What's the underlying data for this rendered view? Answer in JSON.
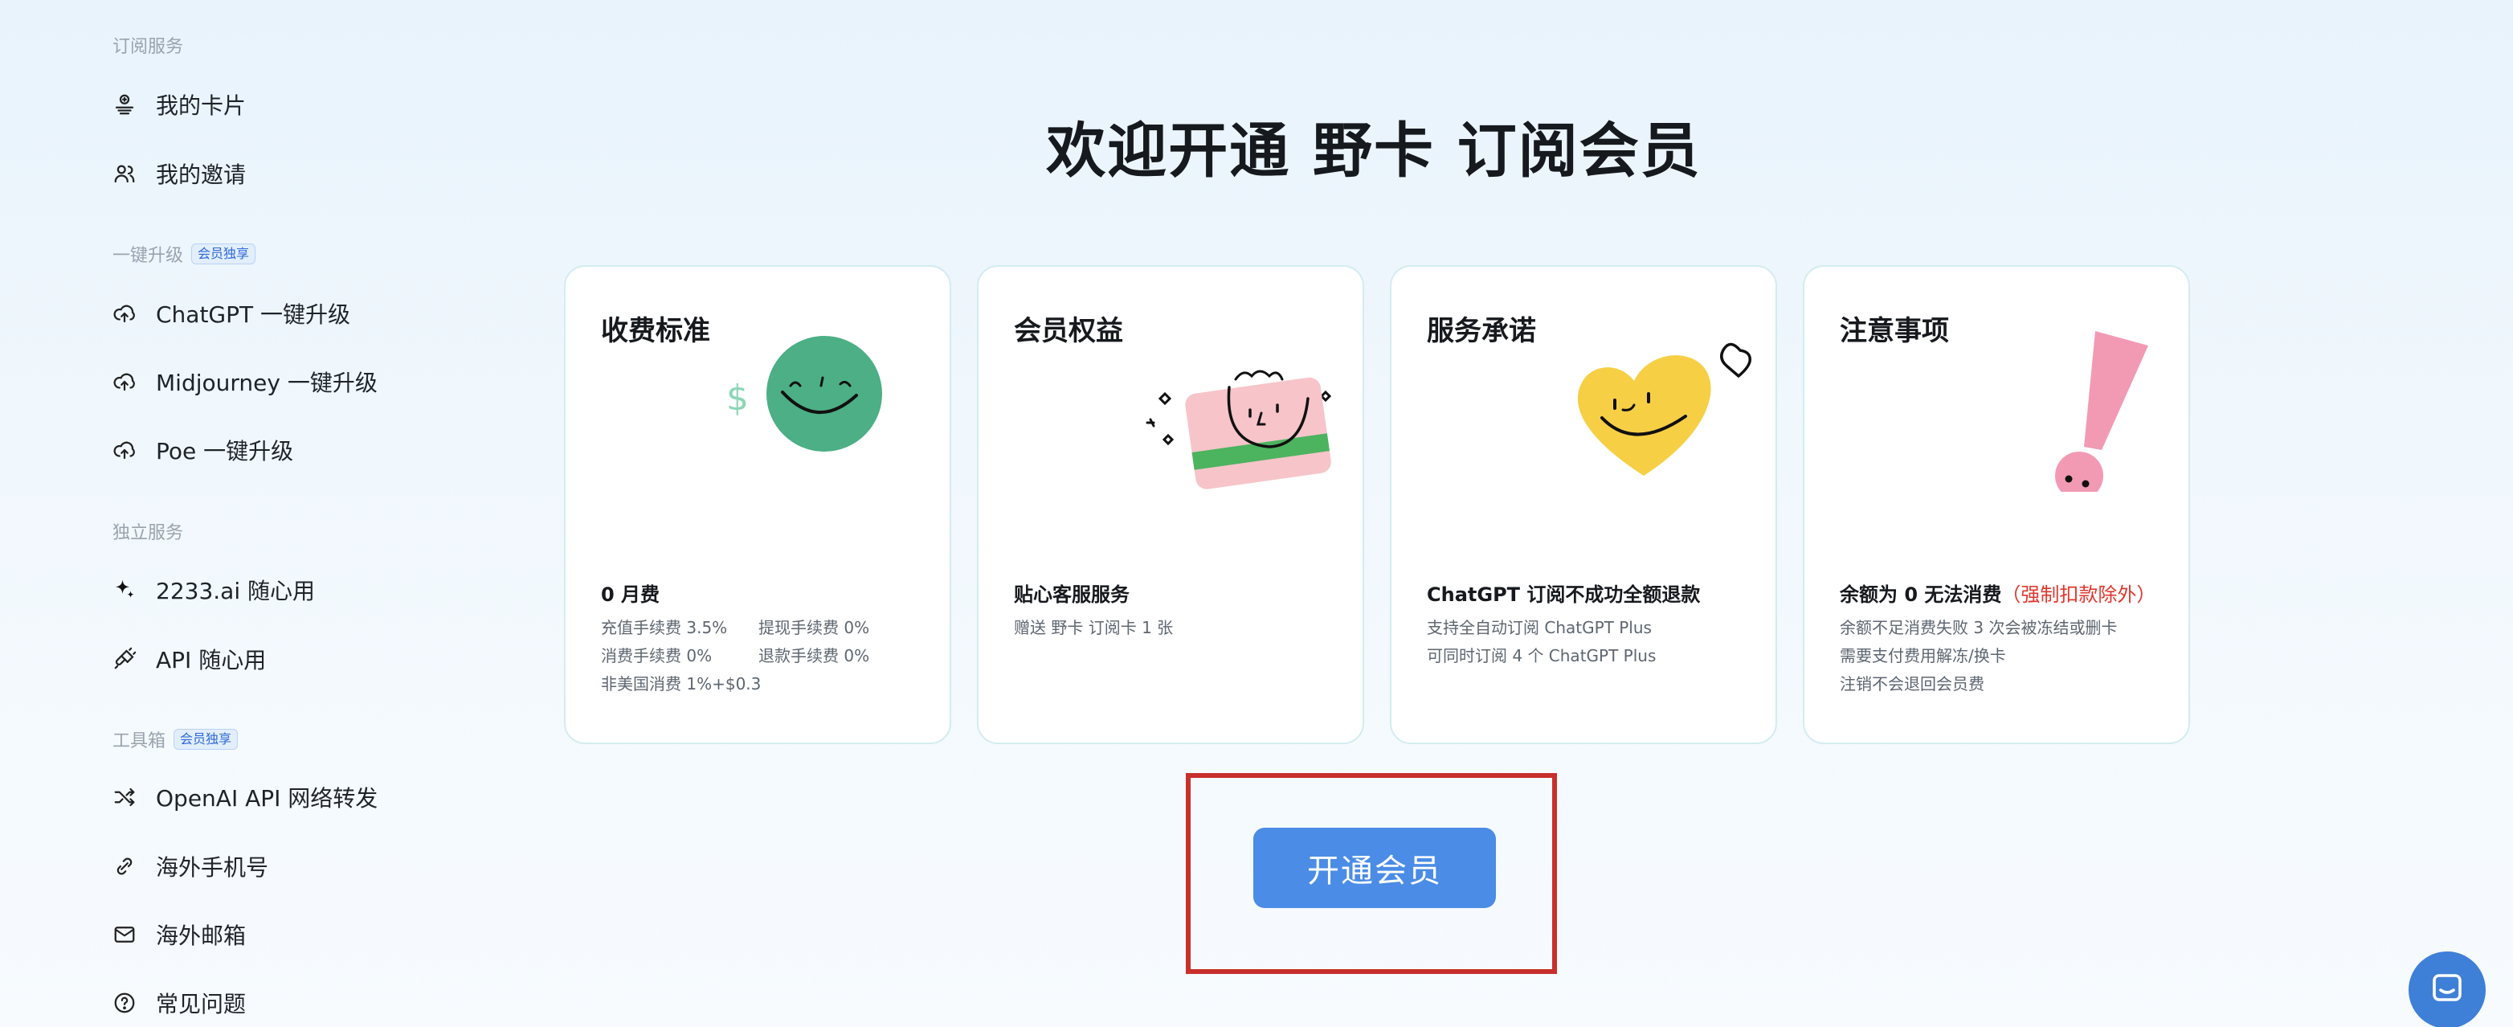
{
  "sidebar": {
    "sections": [
      {
        "label": "订阅服务"
      },
      {
        "label": "一键升级",
        "badge": "会员独享"
      },
      {
        "label": "独立服务"
      },
      {
        "label": "工具箱",
        "badge": "会员独享"
      }
    ],
    "items": [
      {
        "label": "我的卡片",
        "icon": "card-stack-icon"
      },
      {
        "label": "我的邀请",
        "icon": "users-icon"
      },
      {
        "label": "ChatGPT 一键升级",
        "icon": "cloud-upload-icon"
      },
      {
        "label": "Midjourney 一键升级",
        "icon": "cloud-upload-icon"
      },
      {
        "label": "Poe 一键升级",
        "icon": "cloud-upload-icon"
      },
      {
        "label": "2233.ai 随心用",
        "icon": "sparkle-icon"
      },
      {
        "label": "API 随心用",
        "icon": "plug-icon"
      },
      {
        "label": "OpenAI API 网络转发",
        "icon": "shuffle-icon"
      },
      {
        "label": "海外手机号",
        "icon": "phone-icon"
      },
      {
        "label": "海外邮箱",
        "icon": "mail-icon"
      },
      {
        "label": "常见问题",
        "icon": "help-circle-icon"
      }
    ]
  },
  "main": {
    "title": "欢迎开通 野卡 订阅会员",
    "cards": [
      {
        "title": "收费标准",
        "illustration": "smiley-coin-illustration",
        "headline": "0 月费",
        "fees": [
          "充值手续费 3.5%",
          "提现手续费 0%",
          "消费手续费 0%",
          "退款手续费 0%"
        ],
        "extra": "非美国消费 1%+$0.3"
      },
      {
        "title": "会员权益",
        "illustration": "smiley-card-illustration",
        "headline": "贴心客服服务",
        "lines": [
          "赠送 野卡 订阅卡 1 张"
        ]
      },
      {
        "title": "服务承诺",
        "illustration": "smiley-heart-illustration",
        "headline": "ChatGPT 订阅不成功全额退款",
        "lines": [
          "支持全自动订阅 ChatGPT Plus",
          "可同时订阅 4 个 ChatGPT Plus"
        ]
      },
      {
        "title": "注意事项",
        "illustration": "exclamation-illustration",
        "headline": "余额为 0 无法消费",
        "headline_warn": "（强制扣款除外）",
        "lines": [
          "余额不足消费失败 3 次会被冻结或删卡",
          "需要支付费用解冻/换卡",
          "注销不会退回会员费"
        ]
      }
    ],
    "cta_label": "开通会员"
  },
  "colors": {
    "accent": "#4a8ce6",
    "highlight_border": "#c8302b",
    "warning_text": "#e0362c",
    "green": "#4caf85",
    "pink": "#f2a3ba",
    "yellow": "#f7cf45"
  }
}
